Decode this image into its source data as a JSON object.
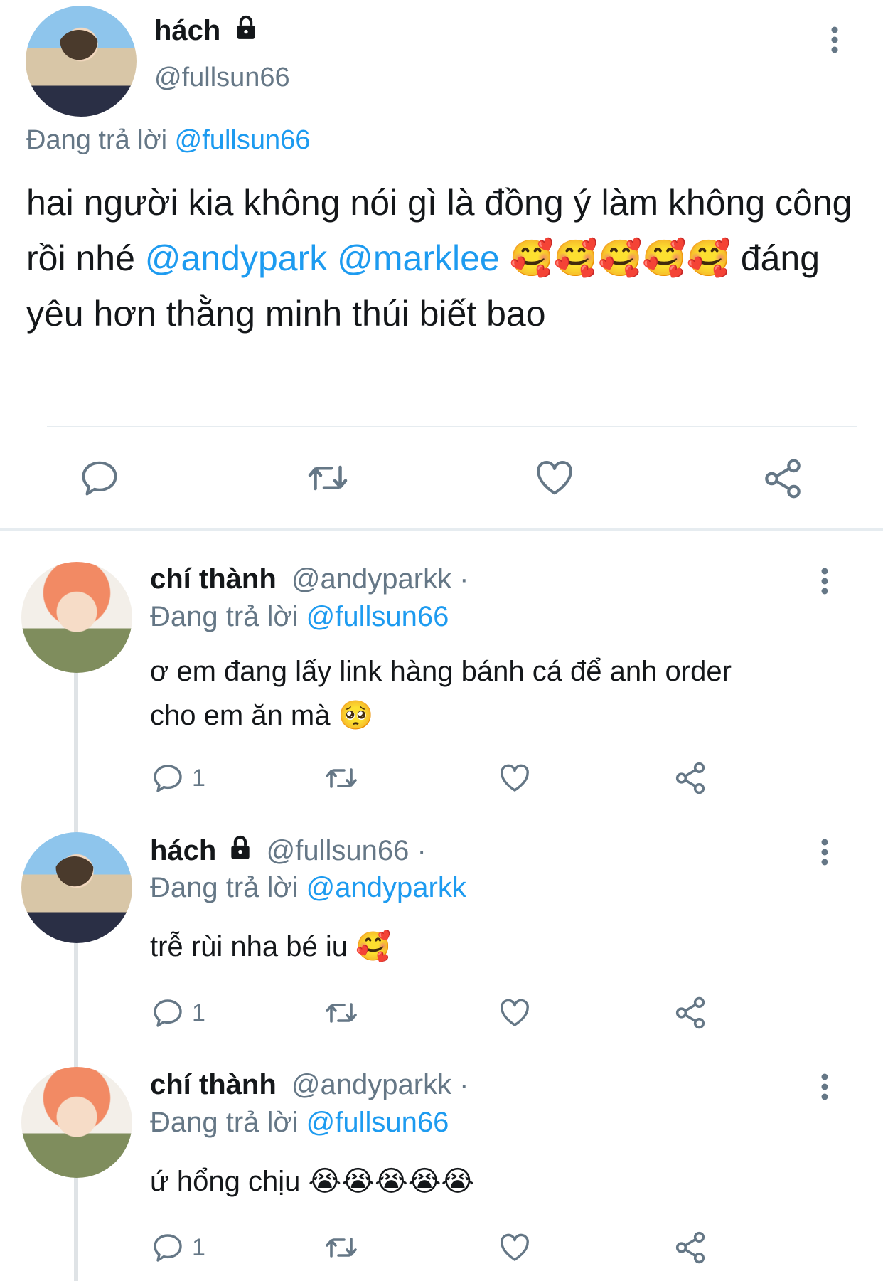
{
  "main": {
    "name": "hách",
    "handle": "@fullsun66",
    "reply_prefix": "Đang trả lời",
    "reply_to": "@fullsun66",
    "text_part1": "hai người kia không nói gì là đồng ý làm không công rồi nhé ",
    "mention1": "@andypark",
    "mention2": "@marklee",
    "emojis": "🥰🥰🥰🥰🥰",
    "text_part2": " đáng yêu hơn thằng minh thúi biết bao"
  },
  "replies": [
    {
      "name": "chí thành",
      "handle": "@andyparkk ·",
      "reply_prefix": "Đang trả lời",
      "reply_to": "@fullsun66",
      "line1": "ơ em đang lấy link hàng bánh cá để anh order",
      "line2": "cho em ăn mà 🥺",
      "reply_count": "1"
    },
    {
      "name": "hách",
      "handle": "@fullsun66 ·",
      "reply_prefix": "Đang trả lời",
      "reply_to": "@andyparkk",
      "line1": "trễ rùi nha bé iu 🥰",
      "reply_count": "1"
    },
    {
      "name": "chí thành",
      "handle": "@andyparkk ·",
      "reply_prefix": "Đang trả lời",
      "reply_to": "@fullsun66",
      "line1": "ứ hổng chịu 😭😭😭😭😭",
      "reply_count": "1"
    }
  ],
  "icons": [
    "lock-icon",
    "more-icon",
    "reply-icon",
    "retweet-icon",
    "like-icon",
    "share-icon"
  ],
  "colors": {
    "link": "#1d9bf0",
    "muted": "#657786",
    "text": "#14171a"
  }
}
